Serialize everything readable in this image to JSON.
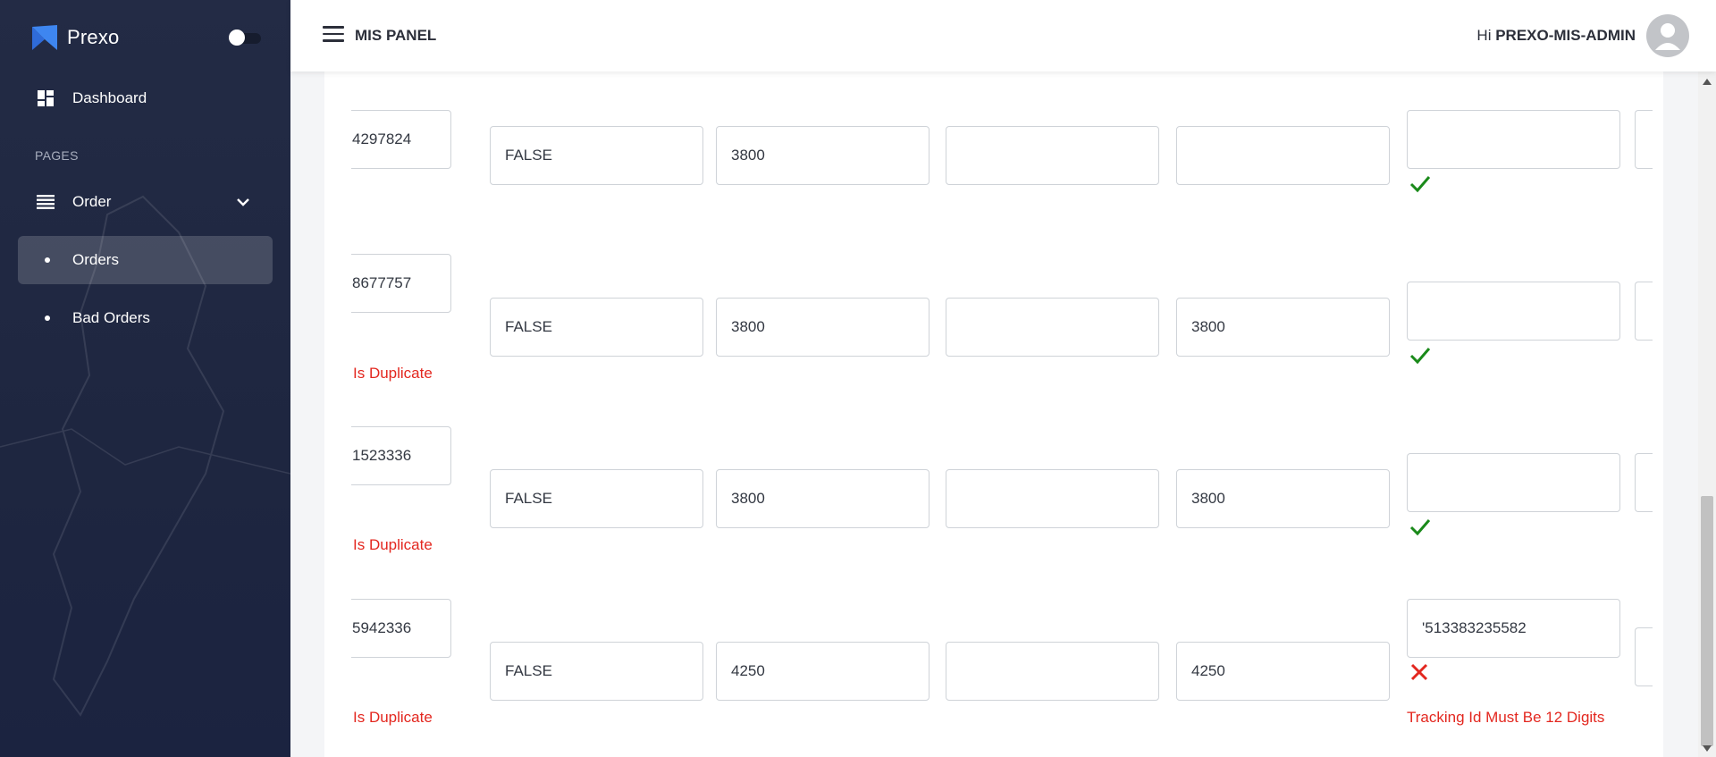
{
  "brand": {
    "name": "Prexo"
  },
  "sidebar": {
    "dashboard_label": "Dashboard",
    "section_label": "PAGES",
    "order_label": "Order",
    "sub_items": [
      {
        "label": "Orders",
        "active": true
      },
      {
        "label": "Bad Orders",
        "active": false
      }
    ]
  },
  "header": {
    "title": "MIS PANEL",
    "greeting_prefix": "Hi",
    "username": "PREXO-MIS-ADMIN"
  },
  "rows": [
    {
      "order_id": "4297824",
      "col2": "FALSE",
      "col3": "3800",
      "col4": "",
      "col5": "",
      "tracking": "",
      "status": "valid",
      "left_error": "",
      "right_error": ""
    },
    {
      "order_id": "8677757",
      "col2": "FALSE",
      "col3": "3800",
      "col4": "",
      "col5": "3800",
      "tracking": "",
      "status": "valid",
      "left_error": "Is Duplicate",
      "right_error": ""
    },
    {
      "order_id": "1523336",
      "col2": "FALSE",
      "col3": "3800",
      "col4": "",
      "col5": "3800",
      "tracking": "",
      "status": "valid",
      "left_error": "Is Duplicate",
      "right_error": ""
    },
    {
      "order_id": "5942336",
      "col2": "FALSE",
      "col3": "4250",
      "col4": "",
      "col5": "4250",
      "tracking": "'513383235582",
      "status": "invalid",
      "left_error": "Is Duplicate",
      "right_error": "Tracking Id Must Be 12 Digits"
    }
  ],
  "colors": {
    "sidebar_bg": "#1e2640",
    "error": "#e3271f",
    "success": "#1a8a1a"
  },
  "icons": [
    "dashboard-icon",
    "list-icon",
    "chevron-down-icon",
    "menu-icon",
    "user-avatar-icon",
    "check-icon",
    "close-icon"
  ]
}
